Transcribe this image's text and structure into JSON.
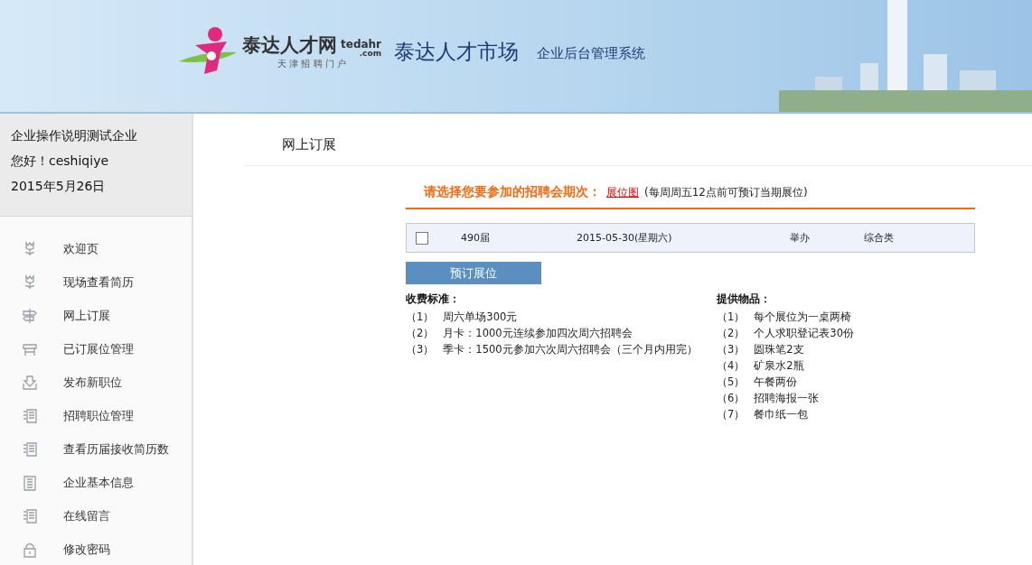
{
  "header": {
    "logo_text": "泰达人才网",
    "logo_domain": "tedahr",
    "logo_domain_suffix": ".com",
    "logo_slogan": "天 津 招 聘 门 户",
    "site_title": "泰达人才市场",
    "system_title": "企业后台管理系统"
  },
  "user_panel": {
    "company": "企业操作说明测试企业",
    "greeting": "您好！",
    "username": "ceshiqiye",
    "date": "2015年5月26日"
  },
  "sidebar": {
    "items": [
      {
        "label": "欢迎页",
        "kind": "tulip"
      },
      {
        "label": "现场查看简历",
        "kind": "tulip"
      },
      {
        "label": "网上订展",
        "kind": "signpost"
      },
      {
        "label": "已订展位管理",
        "kind": "booth"
      },
      {
        "label": "发布新职位",
        "kind": "download"
      },
      {
        "label": "招聘职位管理",
        "kind": "list"
      },
      {
        "label": "查看历届接收简历数",
        "kind": "list"
      },
      {
        "label": "企业基本信息",
        "kind": "clipboard"
      },
      {
        "label": "在线留言",
        "kind": "list"
      },
      {
        "label": "修改密码",
        "kind": "lock"
      }
    ]
  },
  "page": {
    "title": "网上订展",
    "prompt": "请选择您要参加的招聘会期次：",
    "map_link": "展位图",
    "note": "(每周周五12点前可预订当期展位)",
    "sessions": [
      {
        "checked": false,
        "number": "490届",
        "date": "2015-05-30(星期六)",
        "status": "举办",
        "category": "综合类"
      }
    ],
    "book_button": "预订展位",
    "fees": {
      "title": "收费标准：",
      "items": [
        {
          "index": "（1）",
          "text": "周六单场300元"
        },
        {
          "index": "（2）",
          "text": "月卡：1000元连续参加四次周六招聘会"
        },
        {
          "index": "（3）",
          "text": "季卡：1500元参加六次周六招聘会（三个月内用完）"
        }
      ]
    },
    "supplies": {
      "title": "提供物品：",
      "items": [
        {
          "index": "（1）",
          "text": "每个展位为一桌两椅"
        },
        {
          "index": "（2）",
          "text": "个人求职登记表30份"
        },
        {
          "index": "（3）",
          "text": "圆珠笔2支"
        },
        {
          "index": "（4）",
          "text": "矿泉水2瓶"
        },
        {
          "index": "（5）",
          "text": "午餐两份"
        },
        {
          "index": "（6）",
          "text": "招聘海报一张"
        },
        {
          "index": "（7）",
          "text": "餐巾纸一包"
        }
      ]
    }
  }
}
